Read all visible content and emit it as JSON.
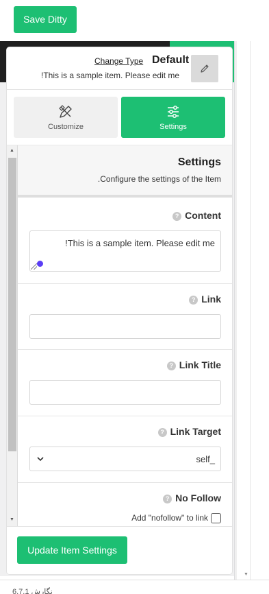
{
  "topbar": {
    "save_label": "Save Ditty"
  },
  "header": {
    "change_type": "Change Type",
    "title": "Default",
    "description": "!This is a sample item. Please edit me"
  },
  "tabs": [
    {
      "label": "Customize",
      "icon": "brush-pencil-icon",
      "active": false
    },
    {
      "label": "Settings",
      "icon": "sliders-icon",
      "active": true
    }
  ],
  "settings": {
    "title": "Settings",
    "description": ".Configure the settings of the Item"
  },
  "fields": {
    "content": {
      "label": "Content",
      "value": "!This is a sample item. Please edit me"
    },
    "link": {
      "label": "Link",
      "value": ""
    },
    "link_title": {
      "label": "Link Title",
      "value": ""
    },
    "link_target": {
      "label": "Link Target",
      "value": "self_"
    },
    "no_follow": {
      "label": "No Follow",
      "checkbox_label": "Add \"nofollow\" to link",
      "checked": false
    }
  },
  "footer": {
    "update_label": "Update Item Settings"
  },
  "version": "6.7.1 نگارش",
  "colors": {
    "accent": "#1dbf73",
    "dark": "#1f1f1f",
    "dot": "#5a3df5"
  }
}
